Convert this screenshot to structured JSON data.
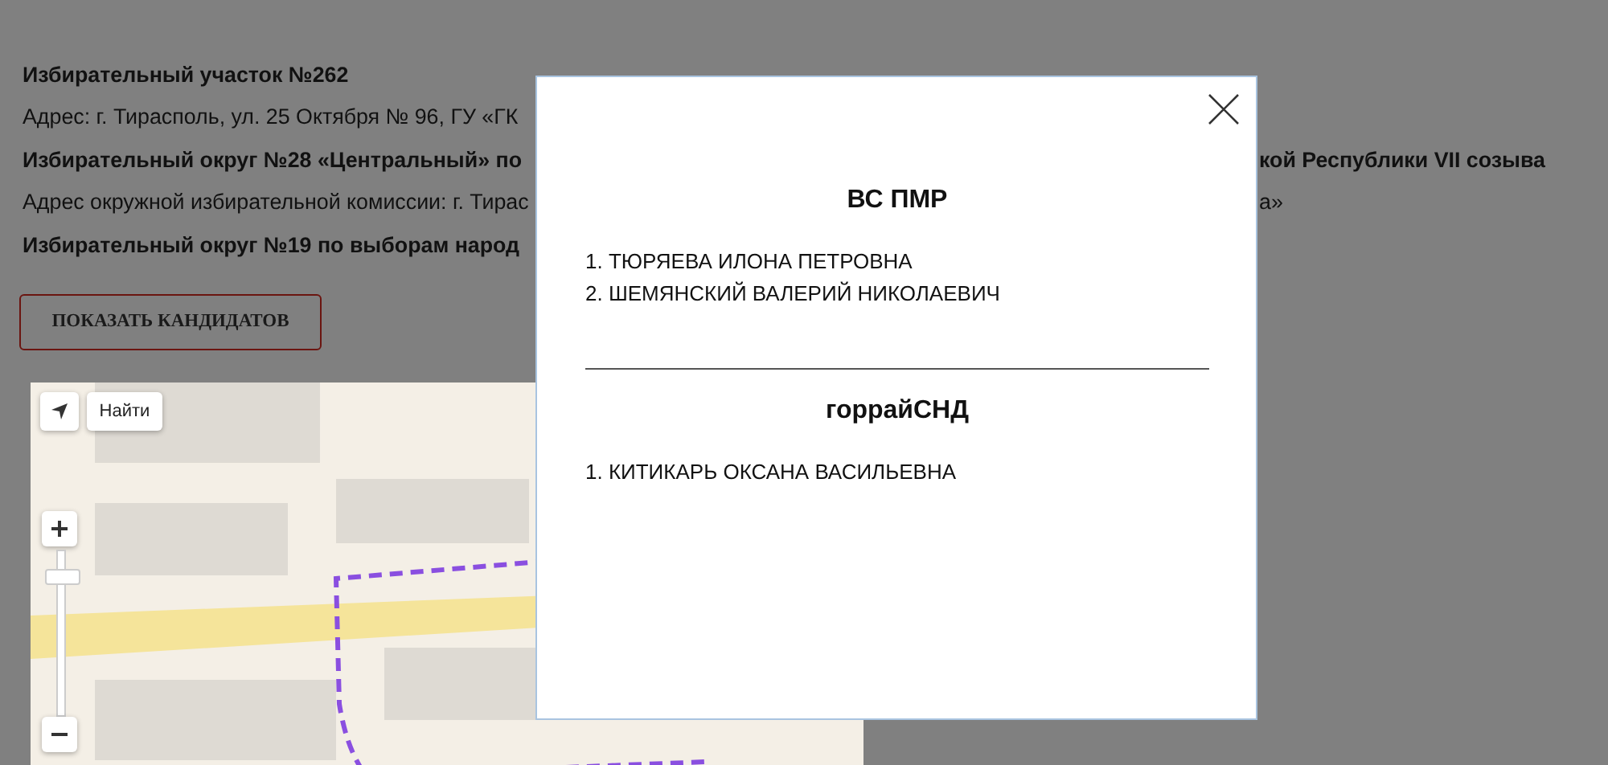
{
  "info_lines": [
    {
      "bold": true,
      "text": "Избирательный участок №262"
    },
    {
      "bold": false,
      "text": "Адрес: г. Тирасполь, ул. 25 Октября № 96, ГУ «ГК"
    },
    {
      "bold": true,
      "text": "Избирательный округ №28 «Центральный» по",
      "tail": "кой Республики VII созыва"
    },
    {
      "bold": false,
      "text": "Адрес окружной избирательной комиссии: г. Тирас",
      "tail": "а»"
    },
    {
      "bold": true,
      "text": "Избирательный округ №19 по выборам народ"
    }
  ],
  "show_candidates_button": "ПОКАЗАТЬ КАНДИДАТОВ",
  "map": {
    "search_button": "Найти"
  },
  "modal": {
    "sections": [
      {
        "title": "ВС ПМР",
        "candidates": [
          "1. ТЮРЯЕВА ИЛОНА ПЕТРОВНА",
          "2. ШЕМЯНСКИЙ ВАЛЕРИЙ НИКОЛАЕВИЧ"
        ]
      },
      {
        "title": "горрайСНД",
        "candidates": [
          "1. КИТИКАРЬ ОКСАНА ВАСИЛЬЕВНА"
        ]
      }
    ]
  }
}
